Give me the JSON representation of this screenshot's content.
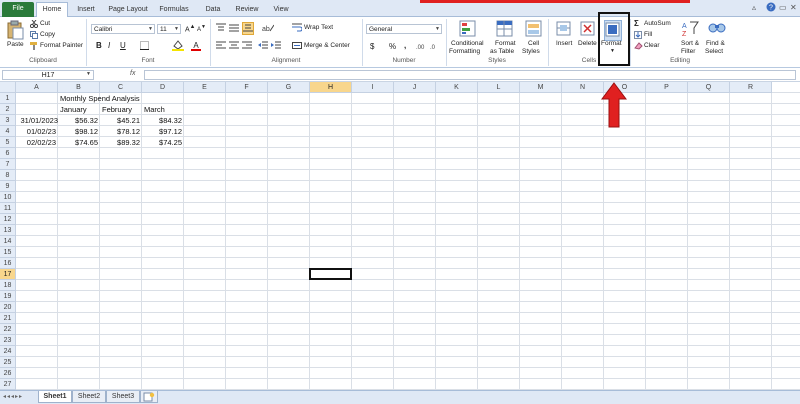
{
  "tabs": [
    {
      "label": "File"
    },
    {
      "label": "Home"
    },
    {
      "label": "Insert"
    },
    {
      "label": "Page Layout"
    },
    {
      "label": "Formulas"
    },
    {
      "label": "Data"
    },
    {
      "label": "Review"
    },
    {
      "label": "View"
    }
  ],
  "ribbon": {
    "clipboard": {
      "paste": "Paste",
      "cut": "Cut",
      "copy": "Copy",
      "format_painter": "Format Painter",
      "label": "Clipboard"
    },
    "font": {
      "name": "Calibri",
      "size": "11",
      "bold": "B",
      "italic": "I",
      "underline": "U",
      "label": "Font"
    },
    "alignment": {
      "wrap_text": "Wrap Text",
      "merge_center": "Merge & Center",
      "label": "Alignment"
    },
    "number": {
      "format": "General",
      "currency": "$",
      "percent": "%",
      "comma": ",",
      "label": "Number"
    },
    "styles": {
      "conditional_1": "Conditional",
      "conditional_2": "Formatting",
      "format_as_1": "Format",
      "format_as_2": "as Table",
      "cell_styles_1": "Cell",
      "cell_styles_2": "Styles",
      "label": "Styles"
    },
    "cells": {
      "insert": "Insert",
      "delete": "Delete",
      "format": "Format",
      "label": "Cells"
    },
    "editing": {
      "autosum": "AutoSum",
      "fill": "Fill",
      "clear": "Clear",
      "sort_1": "Sort &",
      "sort_2": "Filter",
      "find_1": "Find &",
      "find_2": "Select",
      "label": "Editing"
    }
  },
  "formula_bar": {
    "name_box": "H17",
    "fx": "fx",
    "value": ""
  },
  "columns": [
    "A",
    "B",
    "C",
    "D",
    "E",
    "F",
    "G",
    "H",
    "I",
    "J",
    "K",
    "L",
    "M",
    "N",
    "O",
    "P",
    "Q",
    "R"
  ],
  "rows": [
    "1",
    "2",
    "3",
    "4",
    "5",
    "6",
    "7",
    "8",
    "9",
    "10",
    "11",
    "12",
    "13",
    "14",
    "15",
    "16",
    "17",
    "18",
    "19",
    "20",
    "21",
    "22",
    "23",
    "24",
    "25",
    "26",
    "27"
  ],
  "selected": {
    "column": "H",
    "row": "17",
    "ref": "H17"
  },
  "cells": {
    "B1": "Monthly Spend Analysis",
    "B2": "January",
    "C2": "February",
    "D2": "March",
    "A3": "31/01/2023",
    "B3": "$56.32",
    "C3": "$45.21",
    "D3": "$84.32",
    "A4": "01/02/23",
    "B4": "$98.12",
    "C4": "$78.12",
    "D4": "$97.12",
    "A5": "02/02/23",
    "B5": "$74.65",
    "C5": "$89.32",
    "D5": "$74.25"
  },
  "sheets": [
    "Sheet1",
    "Sheet2",
    "Sheet3"
  ],
  "active_sheet": "Sheet1",
  "annotation": {
    "highlight": "format-button",
    "arrow_color": "#e02020"
  }
}
